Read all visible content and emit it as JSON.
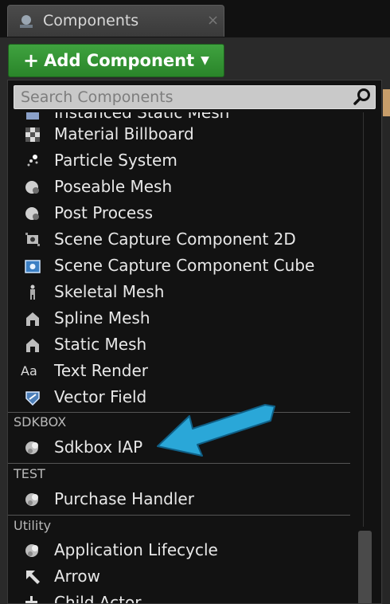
{
  "tab": {
    "title": "Components",
    "close": "×",
    "icon": "component-tab-icon"
  },
  "add_button": {
    "plus": "+",
    "label": "Add Component"
  },
  "search": {
    "placeholder": "Search Components"
  },
  "items": [
    {
      "label": "Instanced Static Mesh",
      "icon": "instanced-static-mesh-icon"
    },
    {
      "label": "Material Billboard",
      "icon": "material-billboard-icon"
    },
    {
      "label": "Particle System",
      "icon": "particle-system-icon"
    },
    {
      "label": "Poseable Mesh",
      "icon": "poseable-mesh-icon"
    },
    {
      "label": "Post Process",
      "icon": "post-process-icon"
    },
    {
      "label": "Scene Capture Component 2D",
      "icon": "scene-capture-2d-icon"
    },
    {
      "label": "Scene Capture Component Cube",
      "icon": "scene-capture-cube-icon"
    },
    {
      "label": "Skeletal Mesh",
      "icon": "skeletal-mesh-icon"
    },
    {
      "label": "Spline Mesh",
      "icon": "spline-mesh-icon"
    },
    {
      "label": "Static Mesh",
      "icon": "static-mesh-icon"
    },
    {
      "label": "Text Render",
      "icon": "text-render-icon",
      "glyph": "Aa"
    },
    {
      "label": "Vector Field",
      "icon": "vector-field-icon"
    }
  ],
  "categories": [
    {
      "name": "SDKBOX",
      "items": [
        {
          "label": "Sdkbox IAP",
          "icon": "sdkbox-iap-icon"
        }
      ]
    },
    {
      "name": "TEST",
      "items": [
        {
          "label": "Purchase Handler",
          "icon": "purchase-handler-icon"
        }
      ]
    },
    {
      "name": "Utility",
      "items": [
        {
          "label": "Application Lifecycle",
          "icon": "application-lifecycle-icon"
        },
        {
          "label": "Arrow",
          "icon": "arrow-icon"
        },
        {
          "label": "Child Actor",
          "icon": "child-actor-icon"
        }
      ]
    }
  ],
  "colors": {
    "accent_green": "#2f952f",
    "callout_arrow": "#2aa7d8"
  }
}
